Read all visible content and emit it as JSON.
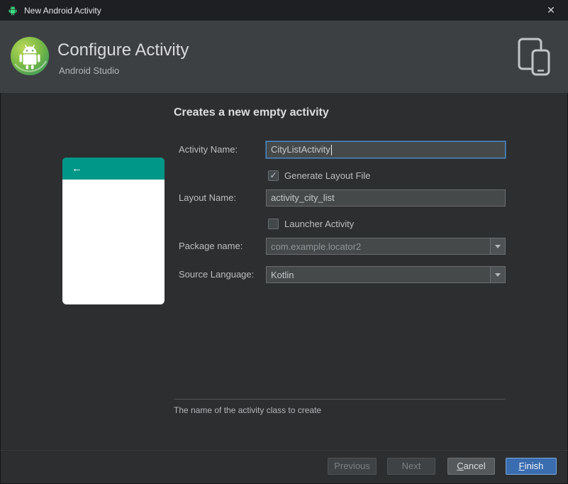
{
  "window": {
    "title": "New Android Activity"
  },
  "icons": {
    "close": "✕",
    "check": "✓",
    "back_arrow": "←",
    "app_icon": "android-robot-icon",
    "logo": "android-studio-logo",
    "device": "phone-and-tablet-icon"
  },
  "header": {
    "title": "Configure Activity",
    "subtitle": "Android Studio"
  },
  "content": {
    "heading": "Creates a new empty activity",
    "fields": {
      "activity_name": {
        "label": "Activity Name:",
        "value": "CityListActivity"
      },
      "generate_layout_file": {
        "label": "Generate Layout File",
        "checked": true
      },
      "layout_name": {
        "label": "Layout Name:",
        "value": "activity_city_list"
      },
      "launcher_activity": {
        "label": "Launcher Activity",
        "checked": false
      },
      "package_name": {
        "label": "Package name:",
        "value": "com.example.locator2"
      },
      "source_language": {
        "label": "Source Language:",
        "value": "Kotlin"
      }
    },
    "hint": "The name of the activity class to create"
  },
  "buttons": {
    "previous": "Previous",
    "next": "Next",
    "cancel": "Cancel",
    "finish": "Finish"
  },
  "colors": {
    "titlebar_bg": "#1e1f22",
    "header_bg": "#3d4043",
    "main_bg": "#2c2e30",
    "accent_teal": "#009688",
    "focus_blue": "#4a88c7",
    "finish_blue": "#3a6cb0"
  }
}
